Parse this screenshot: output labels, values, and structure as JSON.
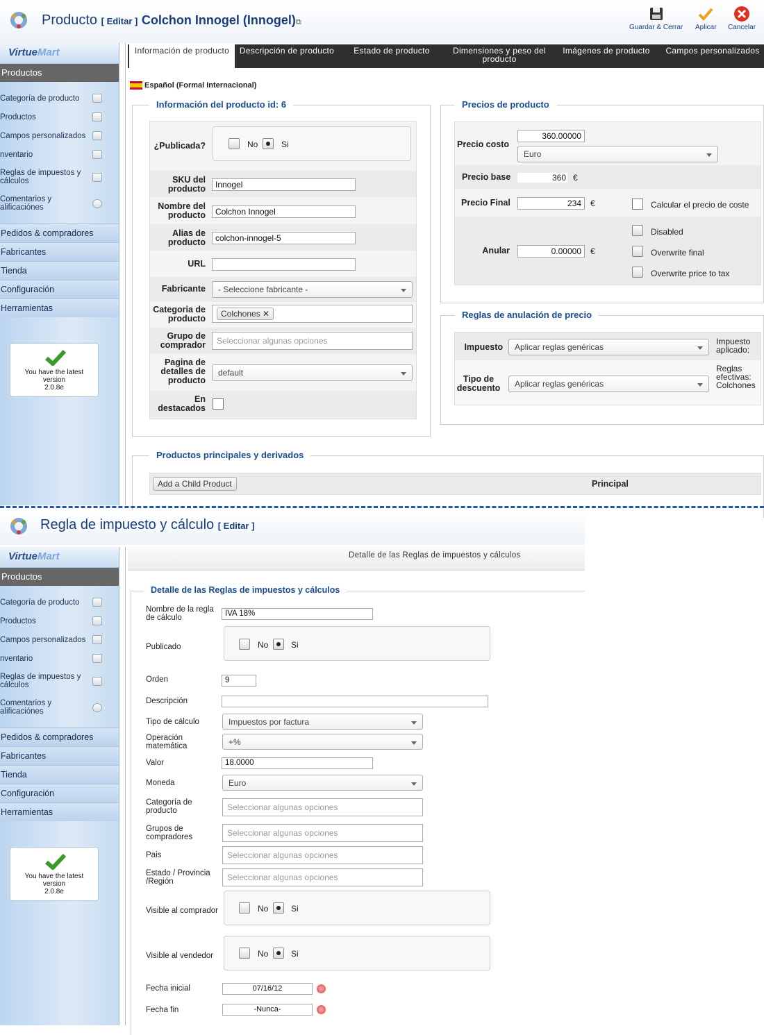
{
  "top": {
    "title": "Producto",
    "edit": "[ Editar ]",
    "product_name": "Colchon Innogel (Innogel)",
    "toolbar": {
      "save_close": "Guardar & Cerrar",
      "apply": "Aplicar",
      "cancel": "Cancelar"
    },
    "sidebar": {
      "logo": [
        "Virtue",
        "Mart"
      ],
      "section": "Productos",
      "items": [
        {
          "label": "Categoría de producto"
        },
        {
          "label": "Productos"
        },
        {
          "label": "Campos personalizados"
        },
        {
          "label": "nventario"
        },
        {
          "label": "Reglas de impuestos y cálculos"
        },
        {
          "label": "Comentarios y alificaciónes"
        }
      ],
      "main": [
        "Pedidos & compradores",
        "Fabricantes",
        "Tienda",
        "Configuración",
        "Herramientas"
      ],
      "latest": [
        "You have the latest",
        "version",
        "2.0.8e"
      ]
    },
    "tabs": [
      "Información de producto",
      "Descripción de producto",
      "Estado de producto",
      "Dimensiones y peso del producto",
      "Imágenes de producto",
      "Campos personalizados"
    ],
    "language": "Español (Formal Internacional)",
    "info": {
      "legend": "Información del producto id: 6",
      "published_label": "¿Publicada?",
      "no": "No",
      "yes": "Si",
      "sku_label": "SKU del producto",
      "sku": "Innogel",
      "name_label": "Nombre del producto",
      "name": "Colchon Innogel",
      "alias_label": "Alias de producto",
      "alias": "colchon-innogel-5",
      "url_label": "URL",
      "url": "",
      "manufacturer_label": "Fabricante",
      "manufacturer": "- Seleccione fabricante -",
      "category_label": "Categoria de producto",
      "category_tag": "Colchones",
      "group_label": "Grupo de comprador",
      "group_placeholder": "Seleccionar algunas opciones",
      "details_label": "Pagina de detalles de producto",
      "details": "default",
      "featured_label": "En destacados"
    },
    "prices": {
      "legend": "Precios de producto",
      "cost_label": "Precio costo",
      "cost": "360.00000",
      "currency": "Euro",
      "base_label": "Precio base",
      "base": "360",
      "euro": "€",
      "final_label": "Precio Final",
      "final": "234",
      "calc_cost": "Calcular el precio de coste",
      "override_label": "Anular",
      "override": "0.00000",
      "disabled": "Disabled",
      "overwrite_final": "Overwrite final",
      "overwrite_tax": "Overwrite price to tax"
    },
    "rules": {
      "legend": "Reglas de anulación de precio",
      "tax_label": "Impuesto",
      "tax": "Aplicar reglas genéricas",
      "tax_applied": "Impuesto aplicado:",
      "discount_label": "Tipo de descuento",
      "discount": "Aplicar reglas genéricas",
      "effective": "Reglas efectivas: Colchones"
    },
    "children": {
      "legend": "Productos principales y derivados",
      "add": "Add a Child Product",
      "principal": "Principal"
    }
  },
  "bottom": {
    "title": "Regla de impuesto y cálculo",
    "edit": "[ Editar ]",
    "tab": "Detalle de las Reglas de impuestos y cálculos",
    "legend": "Detalle de las Reglas de impuestos y cálculos",
    "rule_name_label": "Nombre de la regla de cálculo",
    "rule_name": "IVA 18%",
    "published_label": "Publicado",
    "order_label": "Orden",
    "order": "9",
    "desc_label": "Descripción",
    "calc_type_label": "Tipo de cálculo",
    "calc_type": "Impuestos por factura",
    "math_label": "Operación matemática",
    "math": "+%",
    "value_label": "Valor",
    "value": "18.0000",
    "currency_label": "Moneda",
    "currency": "Euro",
    "cat_label": "Categoría de producto",
    "groups_label": "Grupos de compradores",
    "country_label": "Pais",
    "state_label": "Estado / Provincia /Región",
    "placeholder": "Seleccionar algunas opciones",
    "visible_buyer_label": "Visible al comprador",
    "visible_seller_label": "Visible al vendedor",
    "start_label": "Fecha inicial",
    "start": "07/16/12",
    "end_label": "Fecha fin",
    "end": "-Nunca-"
  }
}
